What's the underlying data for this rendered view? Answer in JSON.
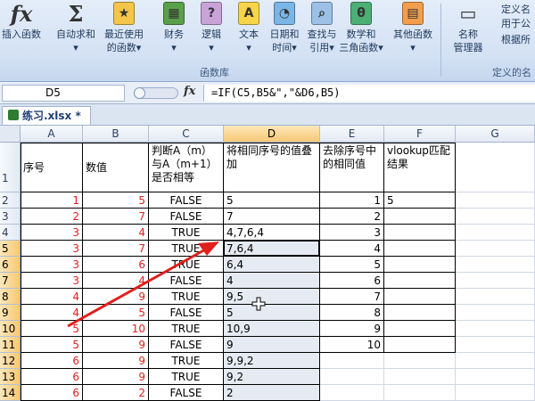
{
  "ribbon": {
    "buttons": [
      {
        "id": "insert-function",
        "line1": "插入函数",
        "line2": "",
        "icon": "fx-icon"
      },
      {
        "id": "autosum",
        "line1": "自动求和",
        "line2": "▾",
        "icon": "sigma-icon"
      },
      {
        "id": "recent",
        "line1": "最近使用",
        "line2": "的函数▾",
        "icon": "star-book-icon"
      },
      {
        "id": "financial",
        "line1": "财务",
        "line2": "▾",
        "icon": "finance-book-icon"
      },
      {
        "id": "logical",
        "line1": "逻辑",
        "line2": "▾",
        "icon": "question-book-icon"
      },
      {
        "id": "text",
        "line1": "文本",
        "line2": "▾",
        "icon": "text-book-icon"
      },
      {
        "id": "datetime",
        "line1": "日期和",
        "line2": "时间▾",
        "icon": "clock-book-icon"
      },
      {
        "id": "lookup",
        "line1": "查找与",
        "line2": "引用▾",
        "icon": "search-book-icon"
      },
      {
        "id": "mathtrig",
        "line1": "数学和",
        "line2": "三角函数▾",
        "icon": "theta-book-icon"
      },
      {
        "id": "more",
        "line1": "其他函数",
        "line2": "▾",
        "icon": "more-books-icon"
      },
      {
        "id": "name-manager",
        "line1": "名称",
        "line2": "管理器",
        "icon": "name-manager-icon"
      }
    ],
    "side_items": [
      "定义名",
      "用于公",
      "根据所"
    ],
    "group_library": "函数库",
    "group_names": "定义的名"
  },
  "formula_bar": {
    "name_box": "D5",
    "fx": "fx",
    "formula": "=IF(C5,B5&\",\"&D6,B5)"
  },
  "workbook_tab": "练习.xlsx *",
  "columns": [
    "A",
    "B",
    "C",
    "D",
    "E",
    "F",
    "G"
  ],
  "selected_column": "D",
  "rows": [
    "1",
    "2",
    "3",
    "4",
    "5",
    "6",
    "7",
    "8",
    "9",
    "10",
    "11",
    "12",
    "13",
    "14"
  ],
  "selected_rows": [
    "5",
    "6",
    "7",
    "8",
    "9",
    "10",
    "11",
    "12",
    "13",
    "14"
  ],
  "headers": [
    "序号",
    "数值",
    "判断A（m）与A（m+1）是否相等",
    "将相同序号的值叠加",
    "去除序号中的相同值",
    "vlookup匹配结果"
  ],
  "data": [
    {
      "a": "1",
      "b": "5",
      "c": "FALSE",
      "d": "5",
      "e": "1",
      "f": "5"
    },
    {
      "a": "2",
      "b": "7",
      "c": "FALSE",
      "d": "7",
      "e": "2",
      "f": ""
    },
    {
      "a": "3",
      "b": "4",
      "c": "TRUE",
      "d": "4,7,6,4",
      "e": "3",
      "f": ""
    },
    {
      "a": "3",
      "b": "7",
      "c": "TRUE",
      "d": "7,6,4",
      "e": "4",
      "f": ""
    },
    {
      "a": "3",
      "b": "6",
      "c": "TRUE",
      "d": "6,4",
      "e": "5",
      "f": ""
    },
    {
      "a": "3",
      "b": "4",
      "c": "FALSE",
      "d": "4",
      "e": "6",
      "f": ""
    },
    {
      "a": "4",
      "b": "9",
      "c": "TRUE",
      "d": "9,5",
      "e": "7",
      "f": ""
    },
    {
      "a": "4",
      "b": "5",
      "c": "FALSE",
      "d": "5",
      "e": "8",
      "f": ""
    },
    {
      "a": "5",
      "b": "10",
      "c": "TRUE",
      "d": "10,9",
      "e": "9",
      "f": ""
    },
    {
      "a": "5",
      "b": "9",
      "c": "FALSE",
      "d": "9",
      "e": "10",
      "f": ""
    },
    {
      "a": "6",
      "b": "9",
      "c": "TRUE",
      "d": "9,9,2",
      "e": "",
      "f": ""
    },
    {
      "a": "6",
      "b": "9",
      "c": "TRUE",
      "d": "9,2",
      "e": "",
      "f": ""
    },
    {
      "a": "6",
      "b": "2",
      "c": "FALSE",
      "d": "2",
      "e": "",
      "f": ""
    }
  ],
  "colors": {
    "red_text": "#e02020",
    "arrow": "#e0201c",
    "selection_header": "#f8c874"
  }
}
